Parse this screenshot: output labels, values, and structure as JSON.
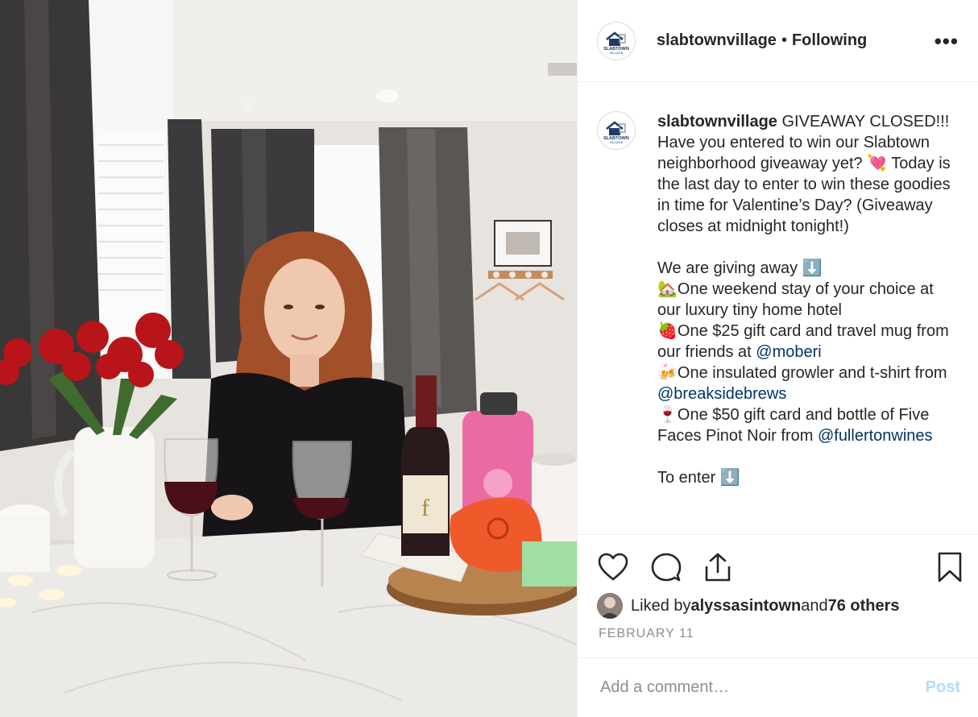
{
  "post": {
    "username": "slabtownvillage",
    "separator": "•",
    "follow_status": "Following",
    "more_icon": "more-horizontal-icon",
    "avatar_text_1": "SLABTOWN",
    "avatar_text_2": "VILLAGE"
  },
  "caption": {
    "username": "slabtownvillage",
    "text_1": " GIVEAWAY CLOSED!!! Have you entered to win our Slabtown neighborhood giveaway yet? 💘 Today is the last day to enter to win these goodies in time for Valentine’s Day? (Giveaway closes at midnight tonight!)\n\nWe are giving away ⬇️\n🏡One weekend stay of your choice at our luxury tiny home hotel\n🍓One $25 gift card and travel mug from our friends at ",
    "mention_1": "@moberi",
    "text_2": "\n🍻One insulated growler and t-shirt from ",
    "mention_2": "@breaksidebrews",
    "text_3": "\n🍷One $50 gift card and bottle of Five Faces Pinot Noir from ",
    "mention_3": "@fullertonwines",
    "text_4": "\n\nTo enter ⬇️"
  },
  "actions": {
    "like_icon": "heart-icon",
    "comment_icon": "comment-icon",
    "share_icon": "share-icon",
    "save_icon": "bookmark-icon"
  },
  "likes": {
    "prefix": "Liked by ",
    "user": "alyssasintown",
    "middle": " and ",
    "others": "76 others"
  },
  "date": "FEBRUARY 11",
  "comment": {
    "placeholder": "Add a comment…",
    "post_label": "Post"
  },
  "colors": {
    "link": "#003569",
    "post_disabled": "#b3dbff",
    "muted": "#8e8e8e",
    "brand_navy": "#1f3a68"
  }
}
